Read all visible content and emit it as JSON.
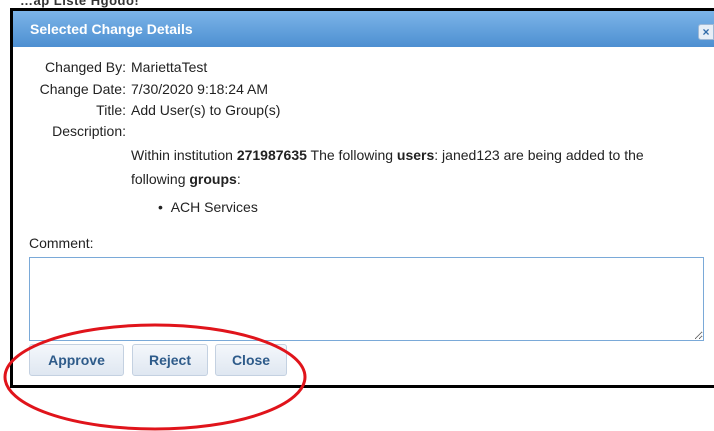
{
  "background": {
    "partial_text": "…ap Liste Hgodo!"
  },
  "dialog": {
    "title": "Selected Change Details",
    "close_glyph": "×",
    "fields": {
      "changed_by": {
        "label": "Changed By:",
        "value": "MariettaTest"
      },
      "change_date": {
        "label": "Change Date:",
        "value": "7/30/2020 9:18:24 AM"
      },
      "title": {
        "label": "Title:",
        "value": "Add User(s) to Group(s)"
      },
      "description": {
        "label": "Description:"
      }
    },
    "description": {
      "p1": "Within institution ",
      "institution": "271987635",
      "p2": " The following ",
      "users_word": "users",
      "p3": ": janed123 are being added to the following ",
      "groups_word": "groups",
      "p4": ":"
    },
    "groups": [
      "ACH Services"
    ],
    "comment": {
      "label": "Comment:",
      "value": "",
      "placeholder": ""
    },
    "buttons": {
      "approve": "Approve",
      "reject": "Reject",
      "close": "Close"
    }
  },
  "colors": {
    "titlebar_top": "#7cb4e8",
    "titlebar_bottom": "#4d8fd1",
    "button_text": "#2e5b8a",
    "annotation": "#e0141b"
  }
}
